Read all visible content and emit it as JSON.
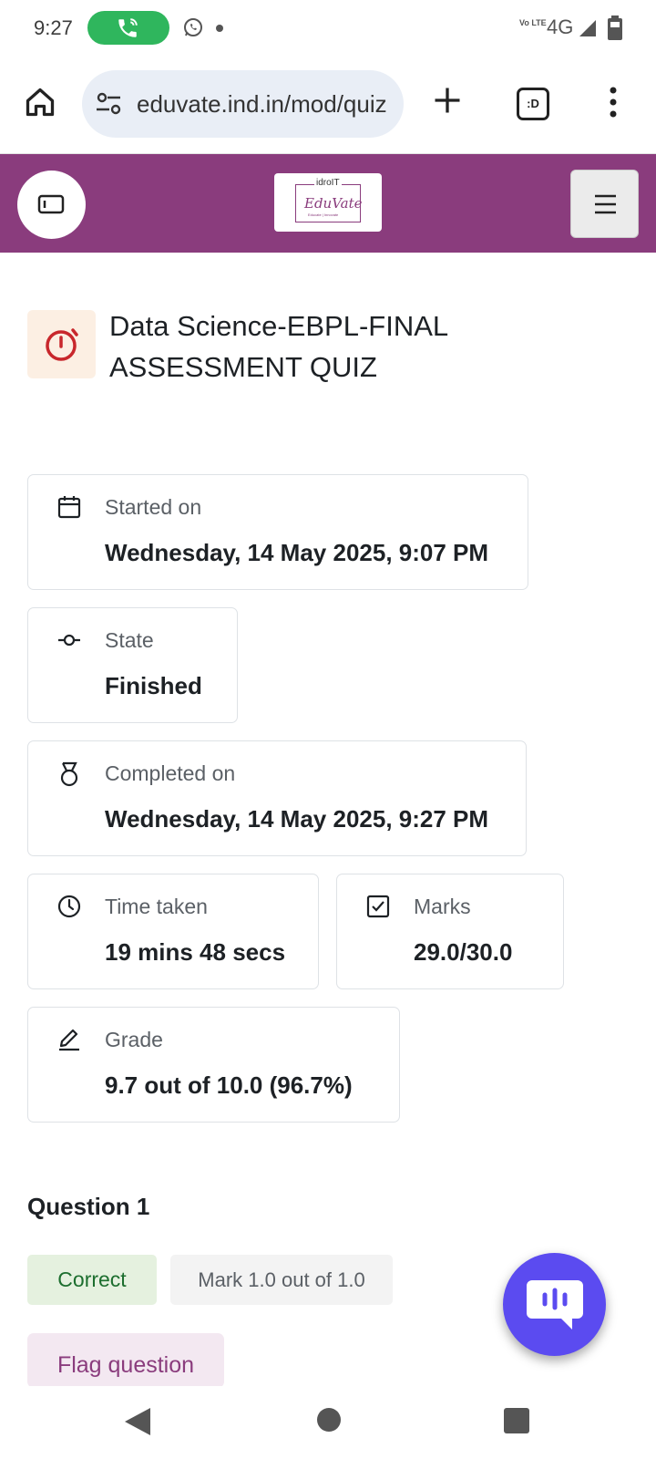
{
  "status_bar": {
    "time": "9:27",
    "volte": "Vo LTE",
    "network": "4G"
  },
  "browser": {
    "url": "eduvate.ind.in/mod/quiz",
    "tabs_count": ":D"
  },
  "header": {
    "logo_top": "idroIT",
    "logo_main": "EduVate",
    "logo_tagline": "Educate | Innovate",
    "accent_color": "#8a3c7d"
  },
  "quiz": {
    "title": "Data Science-EBPL-FINAL ASSESSMENT QUIZ"
  },
  "summary": {
    "started": {
      "label": "Started on",
      "value": "Wednesday, 14 May 2025, 9:07 PM"
    },
    "state": {
      "label": "State",
      "value": "Finished"
    },
    "completed": {
      "label": "Completed on",
      "value": "Wednesday, 14 May 2025, 9:27 PM"
    },
    "time_taken": {
      "label": "Time taken",
      "value": "19 mins 48 secs"
    },
    "marks": {
      "label": "Marks",
      "value": "29.0/30.0"
    },
    "grade": {
      "label": "Grade",
      "value": "9.7 out of 10.0 (96.7%)"
    }
  },
  "question": {
    "title": "Question 1",
    "status": "Correct",
    "mark": "Mark 1.0 out of 1.0",
    "flag_label": "Flag question"
  },
  "icons": [
    "phone-icon",
    "whatsapp-icon",
    "signal-icon",
    "battery-icon",
    "home-icon",
    "tune-icon",
    "plus-icon",
    "more-vert-icon",
    "drawer-icon",
    "hamburger-icon",
    "stopwatch-icon",
    "calendar-icon",
    "state-icon",
    "medal-icon",
    "clock-icon",
    "checkbox-icon",
    "pencil-icon",
    "chat-icon"
  ]
}
